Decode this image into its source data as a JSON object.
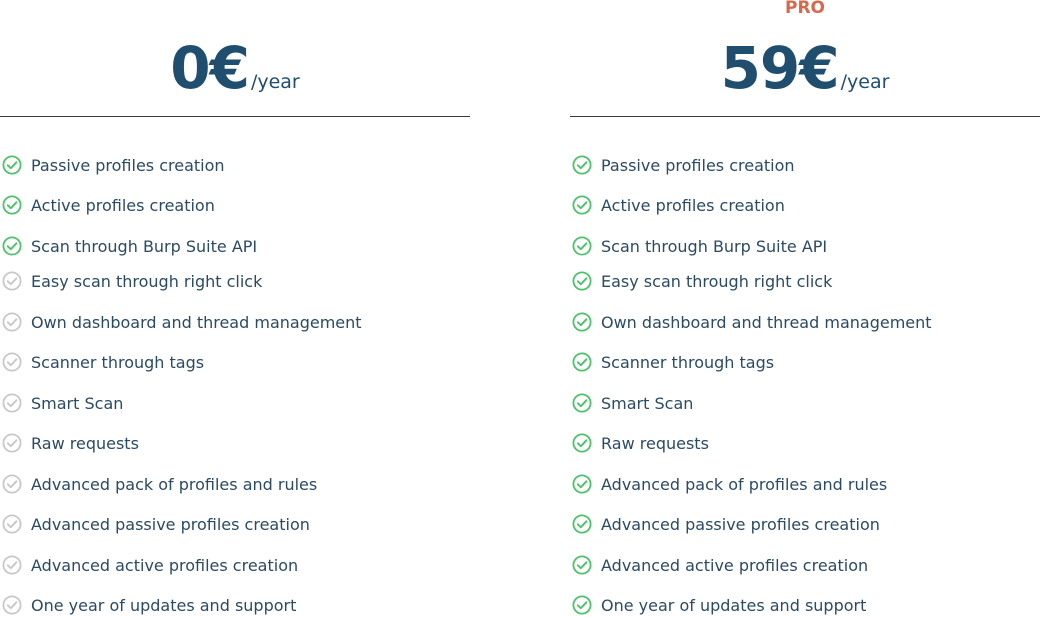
{
  "colors": {
    "price": "#1f4e6f",
    "pro_label": "#d6694d",
    "check_on": "#4cc26a",
    "check_off": "#c8c8c8",
    "feature_text": "#2b4a63"
  },
  "plans": [
    {
      "label": "",
      "price": "0€",
      "period": "/year",
      "features": [
        {
          "text": "Passive profiles creation",
          "included": true
        },
        {
          "text": "Active profiles creation",
          "included": true
        },
        {
          "text": "Scan through Burp Suite API",
          "included": true
        },
        {
          "text": "Easy scan through right click",
          "included": false
        },
        {
          "text": "Own dashboard and thread management",
          "included": false
        },
        {
          "text": "Scanner through tags",
          "included": false
        },
        {
          "text": "Smart Scan",
          "included": false
        },
        {
          "text": "Raw requests",
          "included": false
        },
        {
          "text": "Advanced pack of profiles and rules",
          "included": false
        },
        {
          "text": "Advanced passive profiles creation",
          "included": false
        },
        {
          "text": "Advanced active profiles creation",
          "included": false
        },
        {
          "text": "One year of updates and support",
          "included": false
        }
      ]
    },
    {
      "label": "PRO",
      "price": "59€",
      "period": "/year",
      "features": [
        {
          "text": "Passive profiles creation",
          "included": true
        },
        {
          "text": "Active profiles creation",
          "included": true
        },
        {
          "text": "Scan through Burp Suite API",
          "included": true
        },
        {
          "text": "Easy scan through right click",
          "included": true
        },
        {
          "text": "Own dashboard and thread management",
          "included": true
        },
        {
          "text": "Scanner through tags",
          "included": true
        },
        {
          "text": "Smart Scan",
          "included": true
        },
        {
          "text": "Raw requests",
          "included": true
        },
        {
          "text": "Advanced pack of profiles and rules",
          "included": true
        },
        {
          "text": "Advanced passive profiles creation",
          "included": true
        },
        {
          "text": "Advanced active profiles creation",
          "included": true
        },
        {
          "text": "One year of updates and support",
          "included": true
        }
      ]
    }
  ]
}
